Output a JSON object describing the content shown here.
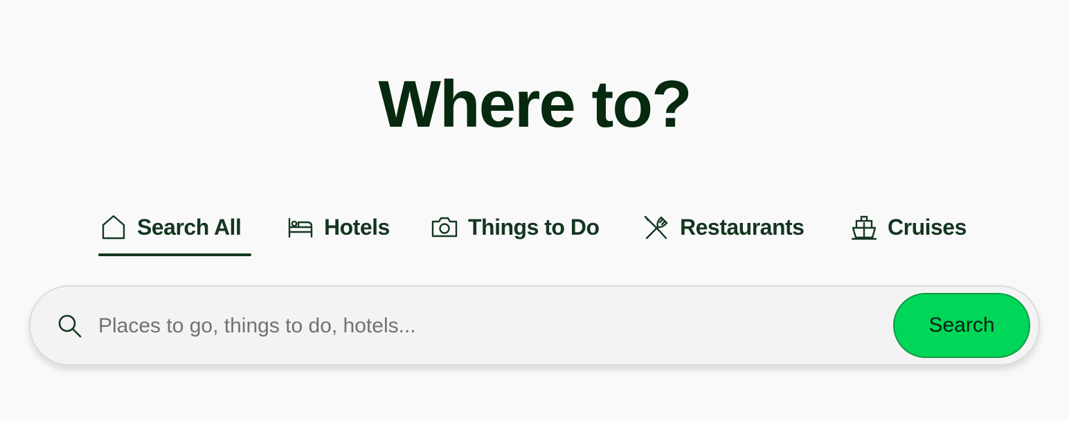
{
  "heading": "Where to?",
  "tabs": [
    {
      "label": "Search All",
      "icon": "home-icon",
      "selected": true
    },
    {
      "label": "Hotels",
      "icon": "bed-icon",
      "selected": false
    },
    {
      "label": "Things to Do",
      "icon": "camera-icon",
      "selected": false
    },
    {
      "label": "Restaurants",
      "icon": "utensils-icon",
      "selected": false
    },
    {
      "label": "Cruises",
      "icon": "ship-icon",
      "selected": false
    }
  ],
  "search": {
    "placeholder": "Places to go, things to do, hotels...",
    "value": "",
    "button_label": "Search",
    "icon": "search-icon"
  },
  "colors": {
    "heading": "#06290f",
    "tab_text": "#143620",
    "button_bg": "#00d658",
    "button_border": "#129a45",
    "background": "#f9f9f9"
  }
}
